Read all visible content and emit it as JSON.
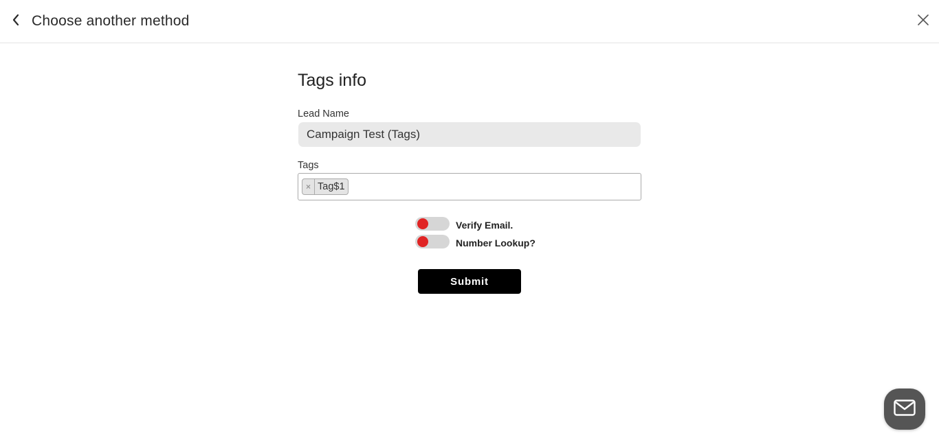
{
  "header": {
    "back_icon": "chevron-left-icon",
    "title": "Choose another method",
    "close_icon": "close-icon"
  },
  "form": {
    "title": "Tags info",
    "lead_name": {
      "label": "Lead Name",
      "value": "Campaign Test (Tags)"
    },
    "tags": {
      "label": "Tags",
      "items": [
        {
          "remove_glyph": "×",
          "label": "Tag$1"
        }
      ]
    },
    "toggles": [
      {
        "label": "Verify Email.",
        "on": false
      },
      {
        "label": "Number Lookup?",
        "on": false
      }
    ],
    "submit_label": "Submit"
  },
  "chat_launcher": {
    "icon": "envelope-icon"
  },
  "colors": {
    "toggle_knob": "#e02424",
    "toggle_track": "#d6d6d6",
    "submit_bg": "#000000",
    "input_bg": "#e9e9e9",
    "chat_bg": "#555555"
  }
}
